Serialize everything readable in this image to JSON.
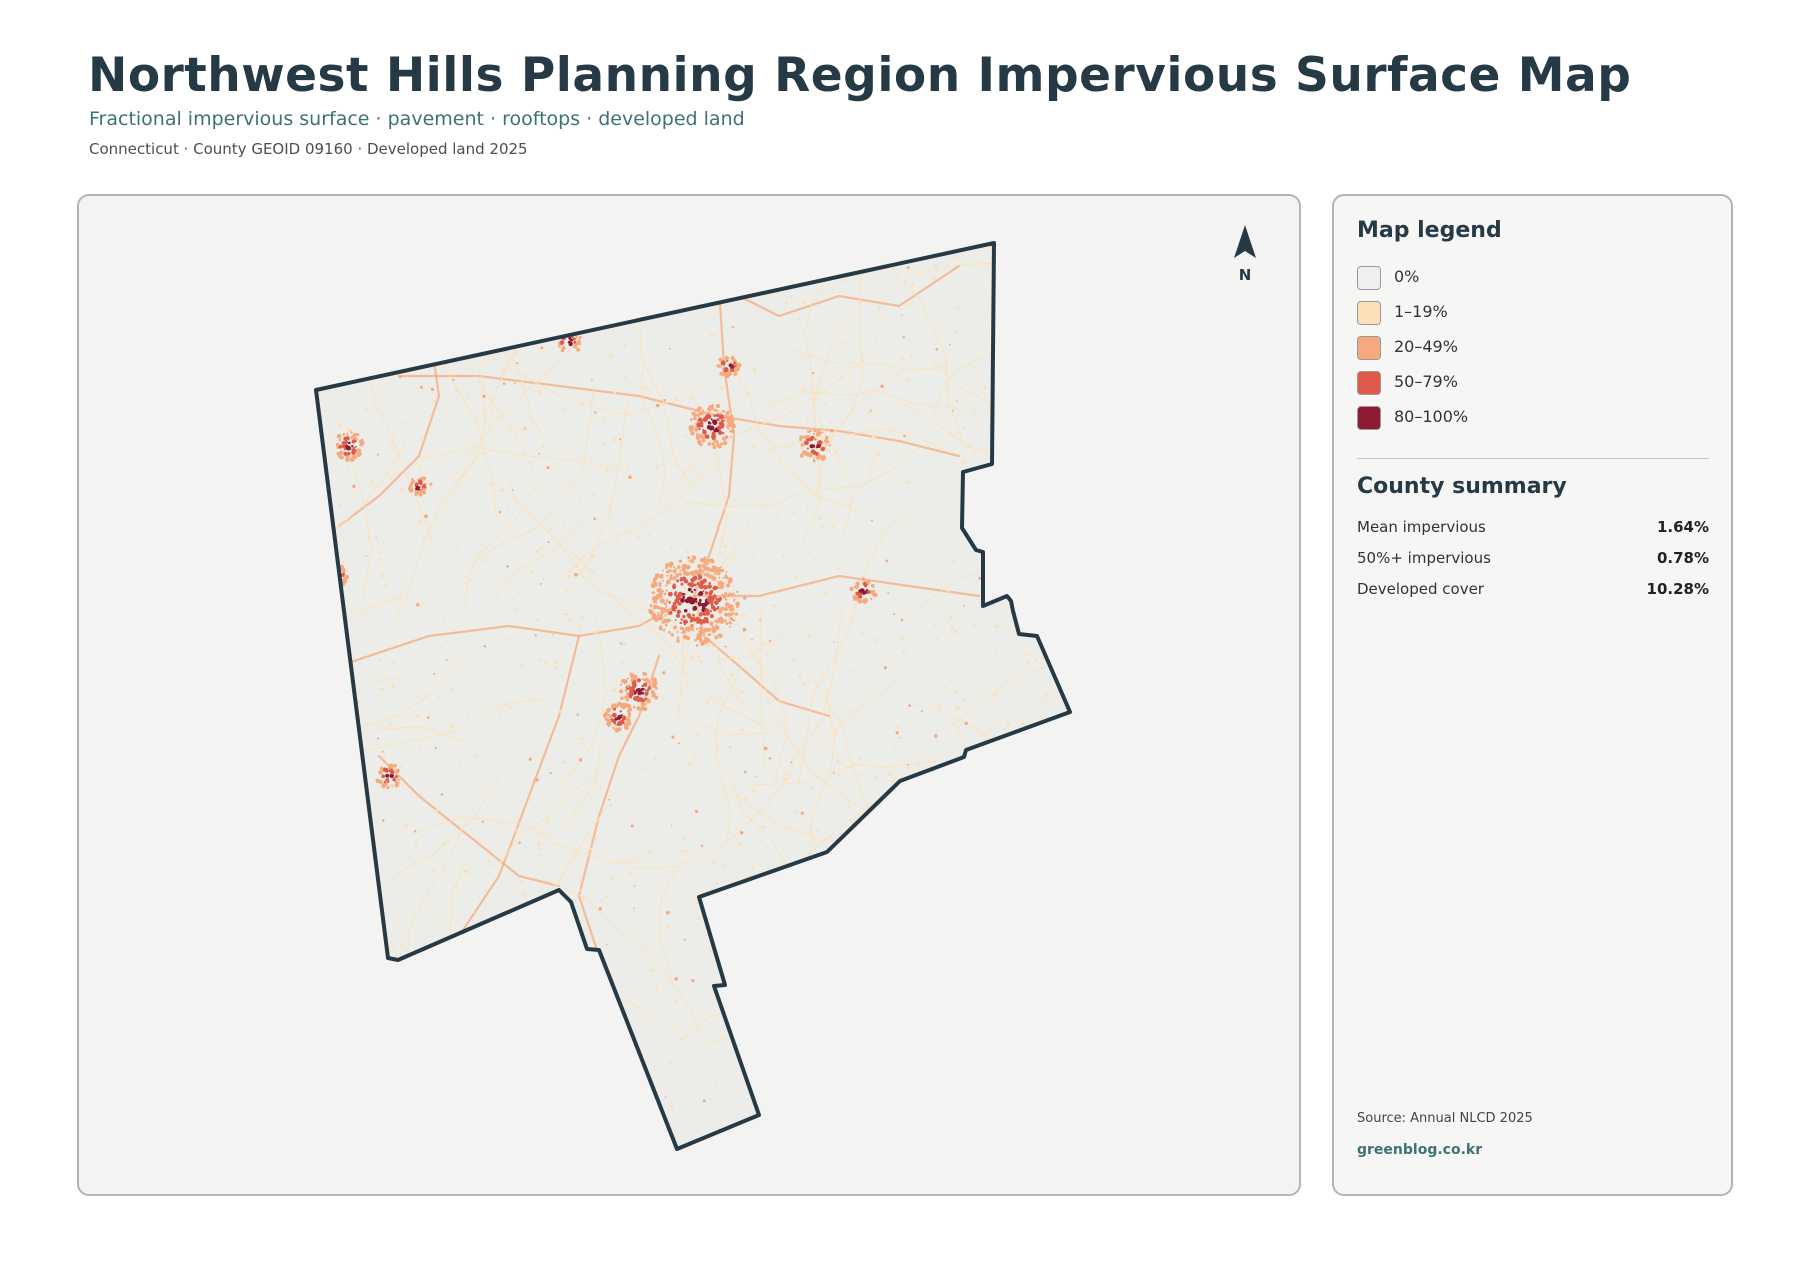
{
  "header": {
    "title": "Northwest Hills Planning Region Impervious Surface Map",
    "subtitle": "Fractional impervious surface · pavement · rooftops · developed land",
    "meta": "Connecticut · County GEOID 09160 · Developed land 2025"
  },
  "map": {
    "north_label": "N",
    "boundary_color": "#253a45",
    "land_color": "#ecede9",
    "background_color": "#f3f3f1"
  },
  "legend": {
    "heading": "Map legend",
    "items": [
      {
        "label": "0%",
        "color": "#efefed"
      },
      {
        "label": "1–19%",
        "color": "#fde0b8"
      },
      {
        "label": "20–49%",
        "color": "#f5a97c"
      },
      {
        "label": "50–79%",
        "color": "#de5b4b"
      },
      {
        "label": "80–100%",
        "color": "#8f1b33"
      }
    ]
  },
  "summary": {
    "heading": "County summary",
    "rows": [
      {
        "label": "Mean impervious",
        "value": "1.64%"
      },
      {
        "label": "50%+ impervious",
        "value": "0.78%"
      },
      {
        "label": "Developed cover",
        "value": "10.28%"
      }
    ]
  },
  "footer": {
    "source": "Source: Annual NLCD 2025",
    "site": "greenblog.co.kr"
  }
}
